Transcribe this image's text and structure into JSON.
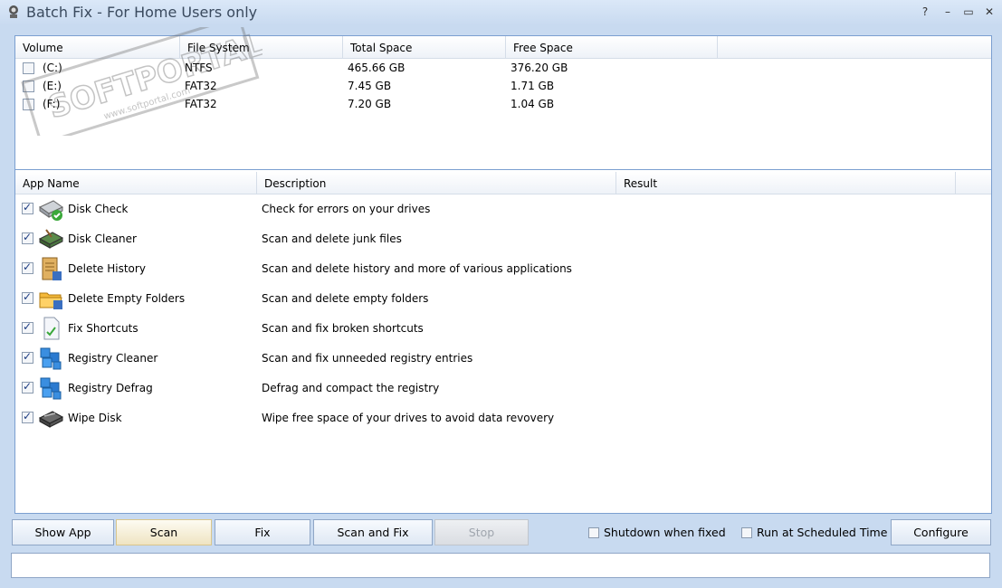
{
  "window": {
    "title": "Batch Fix - For Home Users only",
    "controls": [
      "?",
      "–",
      "▭",
      "✕"
    ]
  },
  "volumes": {
    "headers": [
      "Volume",
      "File System",
      "Total Space",
      "Free Space"
    ],
    "rows": [
      {
        "volume": "(C:)",
        "fs": "NTFS",
        "total": "465.66 GB",
        "free": "376.20 GB",
        "checked": false
      },
      {
        "volume": "(E:)",
        "fs": "FAT32",
        "total": "7.45 GB",
        "free": "1.71 GB",
        "checked": false
      },
      {
        "volume": "(F:)",
        "fs": "FAT32",
        "total": "7.20 GB",
        "free": "1.04 GB",
        "checked": false
      }
    ]
  },
  "apps": {
    "headers": [
      "App Name",
      "Description",
      "Result"
    ],
    "rows": [
      {
        "name": "Disk Check",
        "desc": "Check for errors on your drives",
        "icon": "disk-check-icon",
        "checked": true
      },
      {
        "name": "Disk Cleaner",
        "desc": "Scan and delete junk files",
        "icon": "disk-cleaner-icon",
        "checked": true
      },
      {
        "name": "Delete History",
        "desc": "Scan and delete history and more of various applications",
        "icon": "history-icon",
        "checked": true
      },
      {
        "name": "Delete Empty Folders",
        "desc": "Scan and delete empty folders",
        "icon": "folder-icon",
        "checked": true
      },
      {
        "name": "Fix Shortcuts",
        "desc": "Scan and fix broken shortcuts",
        "icon": "shortcut-icon",
        "checked": true
      },
      {
        "name": "Registry Cleaner",
        "desc": "Scan and fix unneeded registry entries",
        "icon": "registry-icon",
        "checked": true
      },
      {
        "name": "Registry Defrag",
        "desc": "Defrag and compact the registry",
        "icon": "registry-defrag-icon",
        "checked": true
      },
      {
        "name": "Wipe Disk",
        "desc": "Wipe free space of your drives to avoid data revovery",
        "icon": "wipe-disk-icon",
        "checked": true
      }
    ]
  },
  "toolbar": {
    "show_app": "Show App",
    "scan": "Scan",
    "fix": "Fix",
    "scan_and_fix": "Scan and Fix",
    "stop": "Stop",
    "shutdown_label": "Shutdown when fixed",
    "scheduled_label": "Run at Scheduled Time",
    "configure": "Configure"
  },
  "watermark": {
    "line1": "SOFTPORTAL",
    "line2": "www.softportal.com"
  },
  "status": {
    "text": ""
  },
  "colors": {
    "window_bg": "#c8daf0",
    "border": "#7b9fd0",
    "accent_active": "#efe4c2"
  }
}
